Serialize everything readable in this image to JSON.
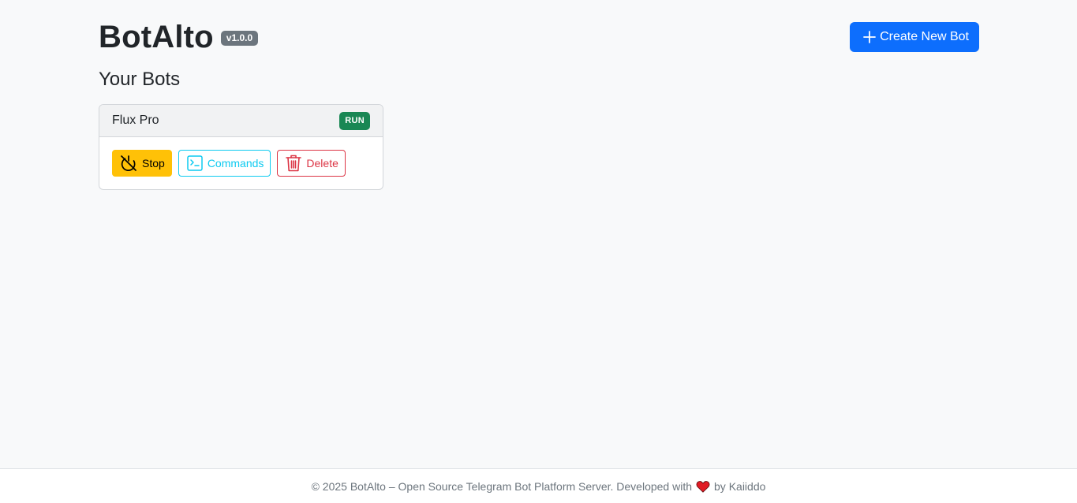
{
  "header": {
    "app_title": "BotAlto",
    "version": "v1.0.0",
    "create_button_label": "Create New Bot"
  },
  "main": {
    "section_title": "Your Bots",
    "bots": [
      {
        "name": "Flux Pro",
        "status": "RUN",
        "actions": {
          "stop_label": "Stop",
          "commands_label": "Commands",
          "delete_label": "Delete"
        }
      }
    ]
  },
  "footer": {
    "text_before": "© 2025 BotAlto – Open Source Telegram Bot Platform Server. Developed with",
    "text_after": "by Kaiiddo"
  },
  "colors": {
    "primary": "#0d6efd",
    "warning": "#ffc107",
    "info": "#0dcaf0",
    "danger": "#dc3545",
    "success": "#198754",
    "secondary": "#6c757d"
  },
  "icons": [
    "plus-icon",
    "power-off-icon",
    "terminal-icon",
    "trash-icon",
    "heart-icon"
  ]
}
